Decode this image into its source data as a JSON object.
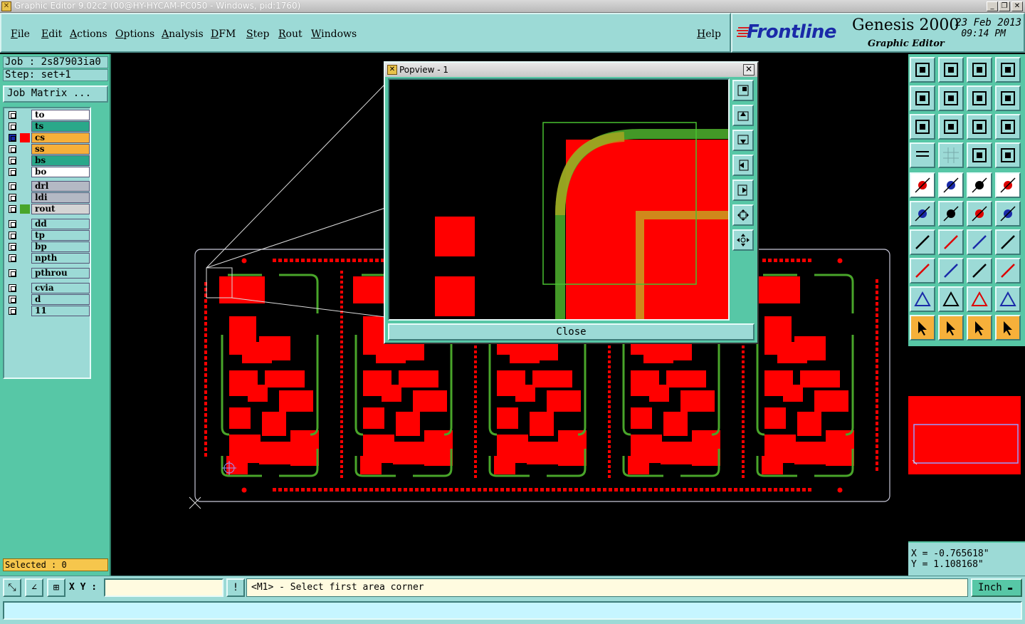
{
  "window": {
    "title": "Graphic Editor 9.02c2 (00@HY-HYCAM-PC050 - Windows, pid:1760)"
  },
  "menu": [
    "File",
    "Edit",
    "Actions",
    "Options",
    "Analysis",
    "DFM",
    "Step",
    "Rout",
    "Windows"
  ],
  "help_label": "Help",
  "brand": {
    "logo": "Frontline",
    "product": "Genesis 2000",
    "subtitle": "Graphic Editor",
    "date": "23 Feb 2013",
    "time": "09:14 PM"
  },
  "job": {
    "job_label": "Job : 2s87903ia0",
    "step_label": "Step: set+1",
    "job_matrix_label": "Job Matrix ..."
  },
  "layers": [
    {
      "name": "to",
      "bg": "#ffffff",
      "sel": ""
    },
    {
      "name": "ts",
      "bg": "#2aa88a",
      "sel": ""
    },
    {
      "name": "cs",
      "bg": "#f6b03a",
      "sel": "#ff0000"
    },
    {
      "name": "ss",
      "bg": "#f6b03a",
      "sel": ""
    },
    {
      "name": "bs",
      "bg": "#2aa88a",
      "sel": ""
    },
    {
      "name": "bo",
      "bg": "#ffffff",
      "sel": ""
    },
    {
      "name": "drl",
      "bg": "#b4b9c4",
      "sel": ""
    },
    {
      "name": "ldi",
      "bg": "#b4b9c4",
      "sel": ""
    },
    {
      "name": "rout",
      "bg": "#d4d4d4",
      "sel": "#49a52a"
    },
    {
      "name": "dd",
      "bg": "#9cdad6",
      "sel": ""
    },
    {
      "name": "tp",
      "bg": "#9cdad6",
      "sel": ""
    },
    {
      "name": "bp",
      "bg": "#9cdad6",
      "sel": ""
    },
    {
      "name": "npth",
      "bg": "#9cdad6",
      "sel": ""
    },
    {
      "name": "pthrou",
      "bg": "#9cdad6",
      "sel": ""
    },
    {
      "name": "cvia",
      "bg": "#9cdad6",
      "sel": ""
    },
    {
      "name": "d",
      "bg": "#9cdad6",
      "sel": ""
    },
    {
      "name": "11",
      "bg": "#9cdad6",
      "sel": ""
    }
  ],
  "selected_label": "Selected : 0",
  "popview": {
    "title": "Popview - 1",
    "close_label": "Close"
  },
  "coords": {
    "x": "X = -0.765618\"",
    "y": "Y =  1.108168\""
  },
  "bottom": {
    "xy_label": "X Y :",
    "xy_value": "",
    "prompt": "<M1> - Select first area corner",
    "units": "Inch"
  },
  "colors": {
    "copper": "#ff0000",
    "rout": "#49a52a",
    "panel": "#9cdad6",
    "background": "#57c7a6"
  },
  "icons": {
    "toolbar": [
      "zoom-home-icon",
      "zoom-step-icon",
      "home-icon",
      "split-view-icon",
      "pan-left-icon",
      "pan-right-icon",
      "undo-view-icon",
      "redraw-icon",
      "fit-icon",
      "zoom-area-icon",
      "scale-1-2-icon",
      "query-icon",
      "measure-icon",
      "grid-icon",
      "layer-snap-icon",
      "layer-snap-alt-icon",
      "feature-add-icon",
      "profile-icon",
      "ruler-icon",
      "pad-icon",
      "connect-icon",
      "cross-icon",
      "line-red-icon",
      "line-blue-icon",
      "angle-icon",
      "diag-line-icon",
      "arc-icon",
      "flip-icon",
      "pad-select-icon",
      "dash-icon",
      "resize-icon",
      "group-icon",
      "triangle-icon",
      "triangle-a-icon",
      "triangle-b-icon",
      "triangle-c-icon",
      "pointer-icon",
      "pointer-box-icon",
      "pointer-select-icon",
      "route-icon"
    ]
  }
}
